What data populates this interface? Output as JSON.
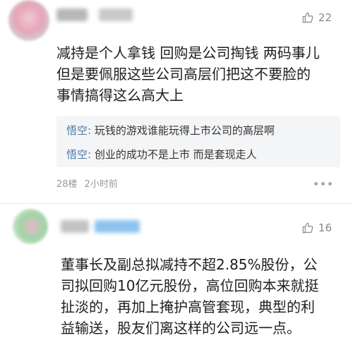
{
  "comments": [
    {
      "likes": "22",
      "text": "减持是个人拿钱 回购是公司掏钱 两码事儿\n但是要佩服这些公司高层们把这不要脸的\n事情搞得这么高大上",
      "replies": [
        {
          "name": "悟空:",
          "text": " 玩钱的游戏谁能玩得上市公司的高层啊"
        },
        {
          "name": "悟空:",
          "text": " 创业的成功不是上市 而是套现走人"
        }
      ],
      "floor": "28楼",
      "time": "2小时前"
    },
    {
      "likes": "16",
      "text": "董事长及副总拟减持不超2.85%股份，公\n司拟回购10亿元股份，高位回购本来就挺\n扯淡的，再加上掩护高管套现，典型的利\n益输送，股友们离这样的公司远一点。"
    }
  ],
  "icons": {
    "like": "thumbs-up-icon",
    "more": "more-dots-icon"
  },
  "colors": {
    "reply_name": "#4d78a6",
    "meta": "#9a9a9a",
    "reply_bg": "#f4f5f7"
  }
}
